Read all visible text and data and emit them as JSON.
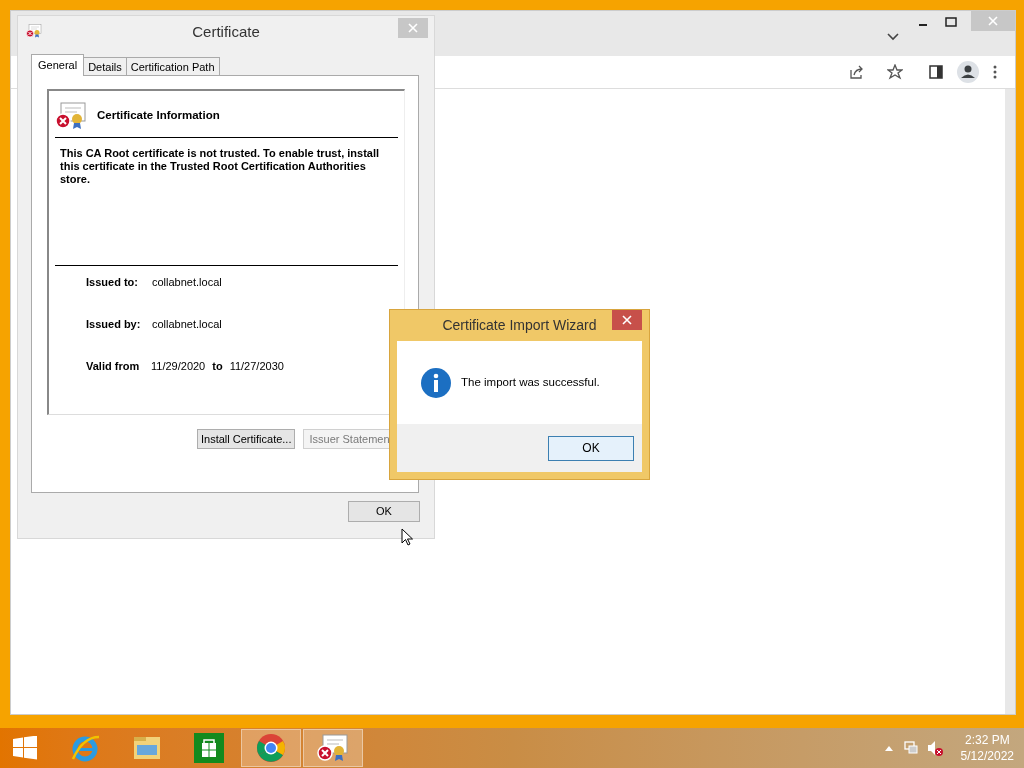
{
  "certificate_dialog": {
    "title": "Certificate",
    "tabs": [
      {
        "label": "General",
        "selected": true
      },
      {
        "label": "Details",
        "selected": false
      },
      {
        "label": "Certification Path",
        "selected": false
      }
    ],
    "heading": "Certificate Information",
    "message": "This CA Root certificate is not trusted. To enable trust, install this certificate in the Trusted Root Certification Authorities store.",
    "fields": [
      {
        "label": "Issued to:",
        "value": "collabnet.local"
      },
      {
        "label": "Issued by:",
        "value": "collabnet.local"
      }
    ],
    "validity": {
      "label": "Valid from",
      "from": "11/29/2020",
      "to_label": "to",
      "to": "11/27/2030"
    },
    "buttons": [
      {
        "label": "Install Certificate...",
        "disabled": false
      },
      {
        "label": "Issuer Statemen",
        "disabled": true
      }
    ],
    "ok": "OK"
  },
  "wizard_dialog": {
    "title": "Certificate Import Wizard",
    "message": "The import was successful.",
    "ok": "OK"
  },
  "taskbar": {
    "apps": [
      {
        "kind": "ie",
        "active": false
      },
      {
        "kind": "explorer",
        "active": false
      },
      {
        "kind": "store",
        "active": false
      },
      {
        "kind": "chrome",
        "active": true
      },
      {
        "kind": "certificate",
        "active": true
      }
    ],
    "time": "2:32 PM",
    "date": "5/12/2022"
  }
}
